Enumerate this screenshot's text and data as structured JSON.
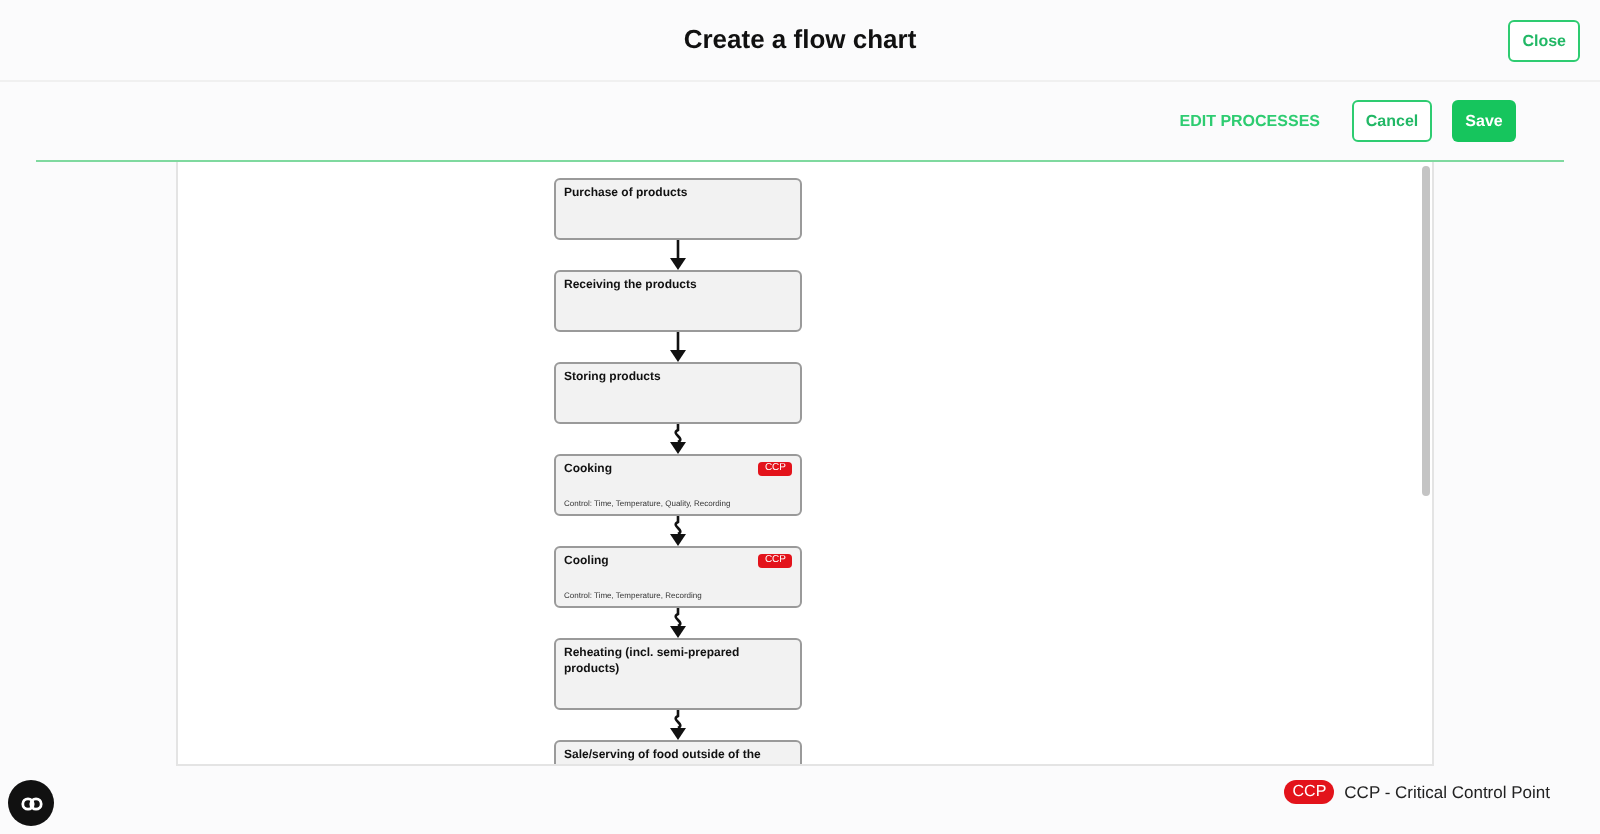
{
  "header": {
    "title": "Create a flow chart",
    "close_label": "Close"
  },
  "toolbar": {
    "edit_label": "EDIT PROCESSES",
    "cancel_label": "Cancel",
    "save_label": "Save"
  },
  "flow": [
    {
      "title": "Purchase of products"
    },
    {
      "title": "Receiving the products"
    },
    {
      "title": "Storing products"
    },
    {
      "title": "Cooking",
      "badge": "CCP",
      "control": "Control: Time, Temperature, Quality, Recording"
    },
    {
      "title": "Cooling",
      "badge": "CCP",
      "control": "Control: Time, Temperature, Recording"
    },
    {
      "title": "Reheating (incl. semi-prepared products)"
    },
    {
      "title": "Sale/serving of food outside of the"
    }
  ],
  "connectors": [
    {
      "kind": "straight"
    },
    {
      "kind": "straight"
    },
    {
      "kind": "wavy"
    },
    {
      "kind": "wavy"
    },
    {
      "kind": "wavy"
    },
    {
      "kind": "wavy"
    }
  ],
  "legend": {
    "badge": "CCP",
    "text": "CCP - Critical Control Point"
  }
}
